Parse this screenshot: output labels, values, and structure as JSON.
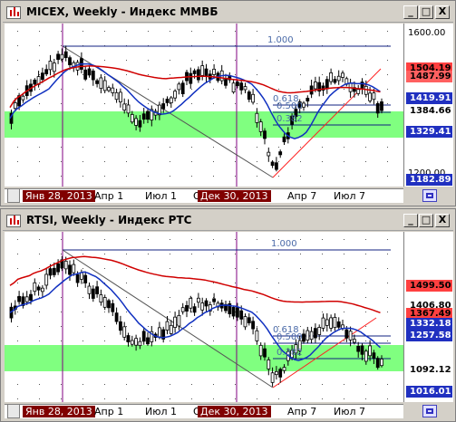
{
  "window_top": {
    "title": "MICEX, Weekly - Индекс ММВБ",
    "buttons": [
      "_",
      "□",
      "X"
    ],
    "y_ticks": [
      {
        "label": "1600.00",
        "value": 1600
      },
      {
        "label": "1200.00",
        "value": 1200
      }
    ],
    "price_tags": [
      {
        "label": "1504.19",
        "value": 1504.19,
        "bg": "#ff4040",
        "fg": "#000000"
      },
      {
        "label": "1487.99",
        "value": 1487.99,
        "bg": "#ff6060",
        "fg": "#000000"
      },
      {
        "label": "1419.91",
        "value": 1419.91,
        "bg": "#2030c0",
        "fg": "#ffffff"
      },
      {
        "label": "1384.66",
        "value": 1384.66,
        "bg": "#ffffff",
        "fg": "#000000"
      },
      {
        "label": "1329.41",
        "value": 1329.41,
        "bg": "#2030c0",
        "fg": "#ffffff"
      },
      {
        "label": "1182.89",
        "value": 1182.89,
        "bg": "#2030c0",
        "fg": "#ffffff"
      }
    ],
    "fib_labels": [
      {
        "label": "1.000",
        "value": 1.0
      },
      {
        "label": "0.618",
        "value": 0.618
      },
      {
        "label": "0.500",
        "value": 0.5
      },
      {
        "label": "0.382",
        "value": 0.382
      }
    ],
    "x_labels": [
      {
        "label": "Янв 28, 2013",
        "highlight": true
      },
      {
        "label": "Апр 1",
        "highlight": false
      },
      {
        "label": "Июл 1",
        "highlight": false
      },
      {
        "label": "Окт 1",
        "highlight": false
      },
      {
        "label": "Дек 30, 2013",
        "highlight": true
      },
      {
        "label": "Апр 7",
        "highlight": false
      },
      {
        "label": "Июл 7",
        "highlight": false
      }
    ]
  },
  "window_bottom": {
    "title": "RTSI, Weekly - Индекс РТС",
    "buttons": [
      "_",
      "□",
      "X"
    ],
    "price_tags": [
      {
        "label": "1499.50",
        "value": 1499.5,
        "bg": "#ff4040",
        "fg": "#000000"
      },
      {
        "label": "1406.80",
        "value": 1406.8,
        "bg": "#ffffff",
        "fg": "#000000"
      },
      {
        "label": "1367.49",
        "value": 1367.49,
        "bg": "#ff4040",
        "fg": "#000000"
      },
      {
        "label": "1332.18",
        "value": 1332.18,
        "bg": "#2030c0",
        "fg": "#ffffff"
      },
      {
        "label": "1257.58",
        "value": 1257.58,
        "bg": "#2030c0",
        "fg": "#ffffff"
      },
      {
        "label": "1092.12",
        "value": 1092.12,
        "bg": "#ffffff",
        "fg": "#000000"
      },
      {
        "label": "1016.01",
        "value": 1016.01,
        "bg": "#2030c0",
        "fg": "#ffffff"
      }
    ],
    "fib_labels": [
      {
        "label": "1.000",
        "value": 1.0
      },
      {
        "label": "0.618",
        "value": 0.618
      },
      {
        "label": "0.500",
        "value": 0.5
      },
      {
        "label": "0.382",
        "value": 0.382
      }
    ],
    "x_labels": [
      {
        "label": "Янв 28, 2013",
        "highlight": true
      },
      {
        "label": "Апр 1",
        "highlight": false
      },
      {
        "label": "Июл 1",
        "highlight": false
      },
      {
        "label": "Окт 1",
        "highlight": false
      },
      {
        "label": "Дек 30, 2013",
        "highlight": true
      },
      {
        "label": "Апр 7",
        "highlight": false
      },
      {
        "label": "Июл 7",
        "highlight": false
      }
    ]
  },
  "colors": {
    "support_zone": "#80ff80",
    "ma_red": "#d00000",
    "ma_blue": "#1030c0",
    "candle": "#000000",
    "fib_line": "#102080",
    "trend_red": "#ff2020",
    "separator": "#800080"
  }
}
